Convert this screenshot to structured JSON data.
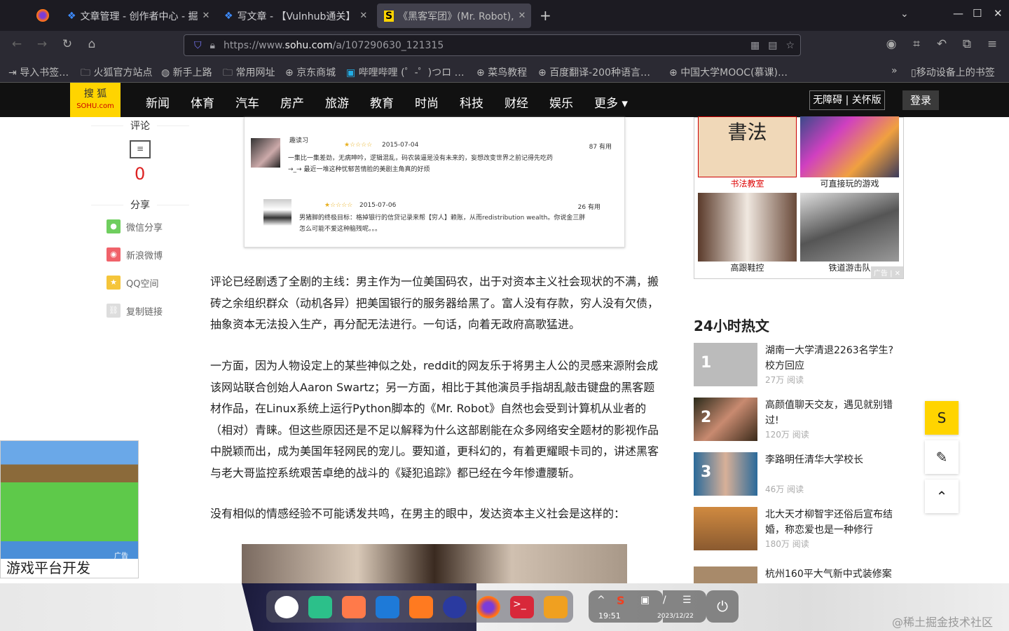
{
  "browser": {
    "tabs": [
      {
        "title": "文章管理 - 创作者中心 - 掘"
      },
      {
        "title": "写文章 - 【Vulnhub通关】"
      },
      {
        "title": "《黑客军团》(Mr. Robot),"
      }
    ],
    "url_prefix": "https://www.",
    "url_domain": "sohu.com",
    "url_path": "/a/107290630_121315",
    "bookmarks": [
      "导入书签…",
      "火狐官方站点",
      "新手上路",
      "常用网址",
      "京东商城",
      "哔哩哔哩 (゜-゜)つロ …",
      "菜鸟教程",
      "百度翻译-200种语言…",
      "中国大学MOOC(慕课)…",
      "移动设备上的书签"
    ]
  },
  "site": {
    "logo_top": "搜 狐",
    "logo_bottom": "SOHU.com",
    "nav": [
      "新闻",
      "体育",
      "汽车",
      "房产",
      "旅游",
      "教育",
      "时尚",
      "科技",
      "财经",
      "娱乐",
      "更多 ▾"
    ],
    "accessibility": "无障碍 | 关怀版",
    "login": "登录"
  },
  "left": {
    "comments_label": "评论",
    "comment_count": "0",
    "share_label": "分享",
    "share": [
      "微信分享",
      "新浪微博",
      "QQ空间",
      "复制链接"
    ]
  },
  "comment_image": {
    "c1_user": "趣读习",
    "c1_date": "2015-07-04",
    "c1_votes": "87 有用",
    "c1_text1": "一集比一集差劲，无病呻吟，逻辑混乱，码农装逼是没有未来的，妄想改变世界之前记得先吃药",
    "c1_text2": "→_→ 最近一堆这种忧郁苦情脸的美剧主角真的好烦",
    "c2_date": "2015-07-06",
    "c2_votes": "26 有用",
    "c2_text1": "男猪脚的终极目标：格掉银行的信贷记录来帮【穷人】赖账，从而redistribution wealth。你说金三胖",
    "c2_text2": "怎么可能不爱这种脑残呢。。。"
  },
  "article": {
    "p1": "评论已经剧透了全剧的主线：男主作为一位美国码农，出于对资本主义社会现状的不满，搬砖之余组织群众（动机各异）把美国银行的服务器给黑了。富人没有存款，穷人没有欠债，抽象资本无法投入生产，再分配无法进行。一句话，向着无政府高歌猛进。",
    "p2": "一方面，因为人物设定上的某些神似之处，reddit的网友乐于将男主人公的灵感来源附会成该网站联合创始人Aaron Swartz；另一方面，相比于其他演员手指胡乱敲击键盘的黑客题材作品，在Linux系统上运行Python脚本的《Mr. Robot》自然也会受到计算机从业者的（相对）青睐。但这些原因还是不足以解释为什么这部剧能在众多网络安全题材的影视作品中脱颖而出，成为美国年轻网民的宠儿。要知道，更科幻的，有着更耀眼卡司的，讲述黑客与老大哥监控系统艰苦卓绝的战斗的《疑犯追踪》都已经在今年惨遭腰斩。",
    "p3": "没有相似的情感经验不可能诱发共鸣，在男主的眼中，发达资本主义社会是这样的："
  },
  "ad_grid": {
    "items": [
      "书法教室",
      "可直接玩的游戏",
      "高跟鞋控",
      "铁道游击队"
    ],
    "ad_label": "广告"
  },
  "ad_left": {
    "caption": "游戏平台开发",
    "ad_label": "广告"
  },
  "hot": {
    "title": "24小时热文",
    "items": [
      {
        "rank": "1",
        "title": "湖南一大学清退2263名学生?校方回应",
        "reads": "27万 阅读"
      },
      {
        "rank": "2",
        "title": "高颜值聊天交友，遇见就别错过!",
        "reads": "120万 阅读"
      },
      {
        "rank": "3",
        "title": "李路明任清华大学校长",
        "reads": "46万 阅读"
      },
      {
        "rank": "",
        "title": "北大天才柳智宇还俗后宣布结婚，称恋爱也是一种修行",
        "reads": "180万 阅读"
      },
      {
        "rank": "",
        "title": "杭州160平大气新中式装修案",
        "reads": ""
      }
    ]
  },
  "taskbar": {
    "time": "19:51",
    "date": "2023/12/22"
  },
  "watermark": "@稀土掘金技术社区"
}
